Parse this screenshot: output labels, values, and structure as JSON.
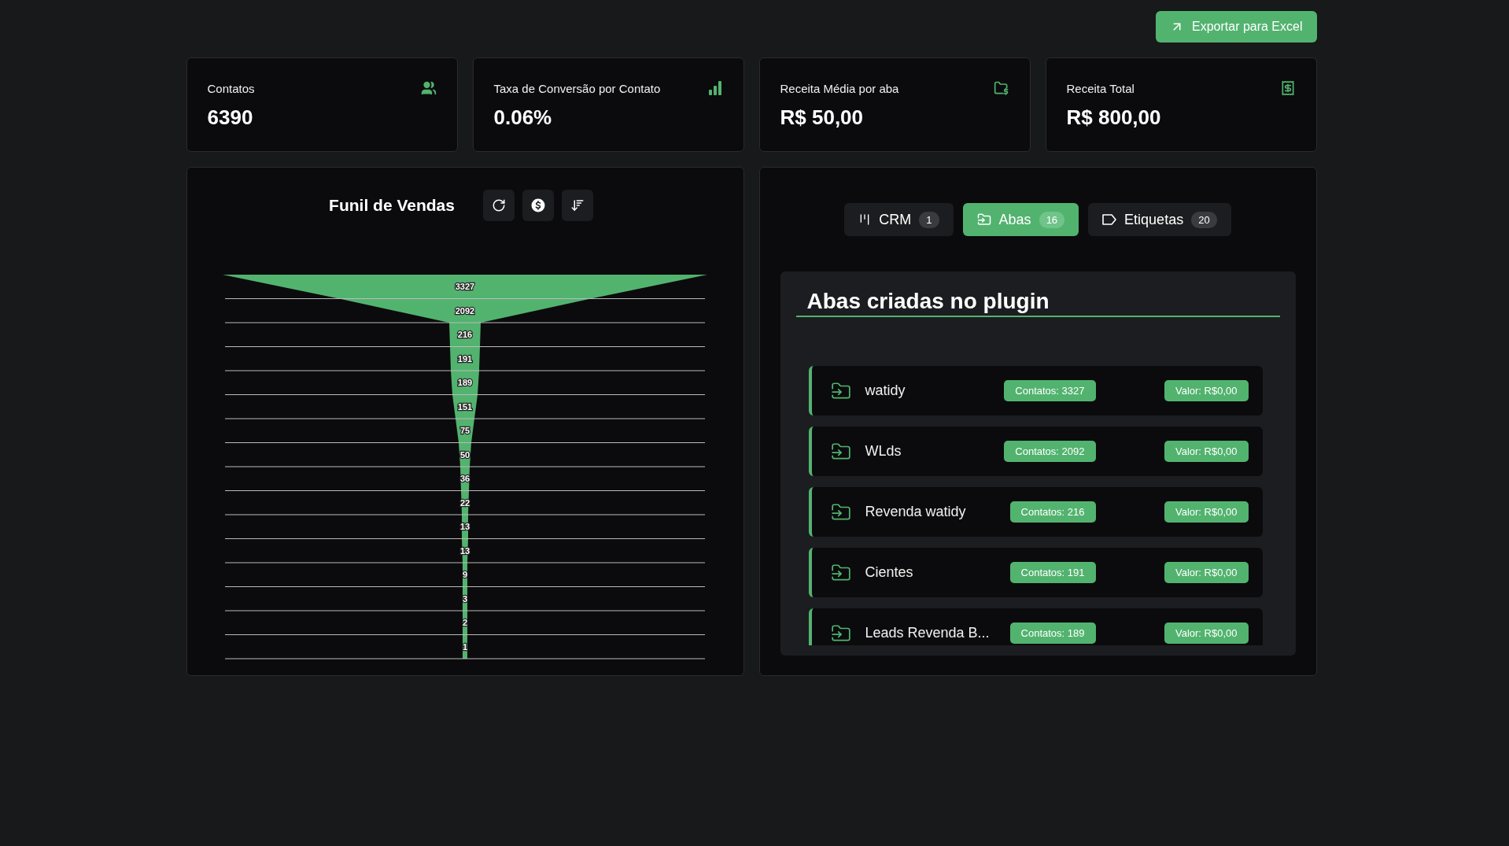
{
  "header": {
    "export_button": "Exportar para Excel"
  },
  "stats": [
    {
      "kind": "contacts",
      "label": "Contatos",
      "value": "6390"
    },
    {
      "kind": "conversion",
      "label": "Taxa de Conversão por Contato",
      "value": "0.06%"
    },
    {
      "kind": "average",
      "label": "Receita Média por aba",
      "value": "R$ 50,00"
    },
    {
      "kind": "total",
      "label": "Receita Total",
      "value": "R$ 800,00"
    }
  ],
  "funnel": {
    "title": "Funil de Vendas",
    "stage_counts": [
      "3327",
      "2092",
      "216",
      "191",
      "189",
      "151",
      "75",
      "50",
      "36",
      "22",
      "13",
      "13",
      "9",
      "3",
      "2",
      "1"
    ]
  },
  "tabs": [
    {
      "kind": "crm",
      "label": "CRM",
      "count": "1",
      "selected": false
    },
    {
      "kind": "folders",
      "label": "Abas",
      "count": "16",
      "selected": true
    },
    {
      "kind": "tags",
      "label": "Etiquetas",
      "count": "20",
      "selected": false
    }
  ],
  "tab_panel": {
    "title": "Abas criadas no plugin",
    "rows": [
      {
        "name": "watidy",
        "contacts": "Contatos: 3327",
        "value": "Valor: R$0,00"
      },
      {
        "name": "WLds",
        "contacts": "Contatos: 2092",
        "value": "Valor: R$0,00"
      },
      {
        "name": "Revenda watidy",
        "contacts": "Contatos: 216",
        "value": "Valor: R$0,00"
      },
      {
        "name": "Cientes",
        "contacts": "Contatos: 191",
        "value": "Valor: R$0,00"
      },
      {
        "name": "Leads Revenda B...",
        "contacts": "Contatos: 189",
        "value": "Valor: R$0,00"
      }
    ]
  }
}
